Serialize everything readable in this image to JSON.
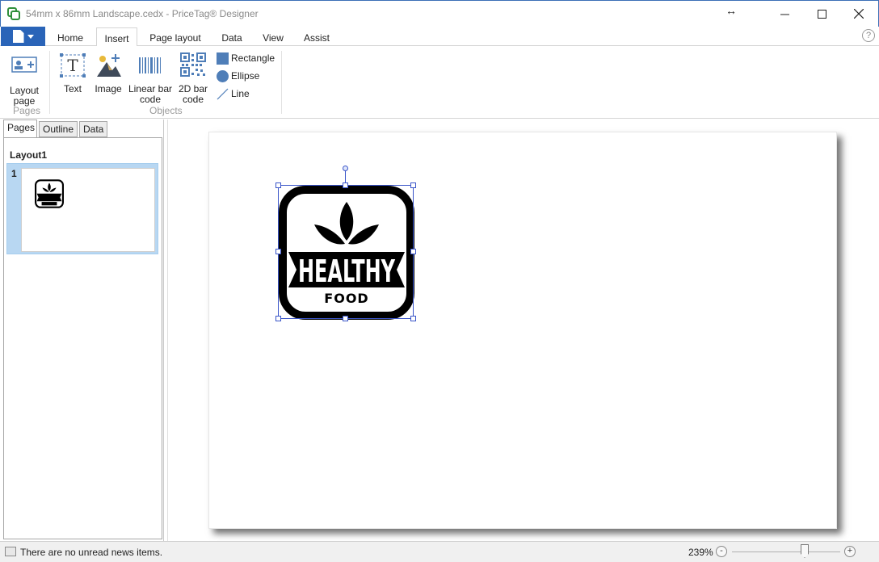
{
  "window": {
    "title": "54mm x 86mm Landscape.cedx - PriceTag® Designer",
    "resize_glyph": "↔"
  },
  "ribbon": {
    "tabs": [
      {
        "label": "Home",
        "active": false
      },
      {
        "label": "Insert",
        "active": true
      },
      {
        "label": "Page layout",
        "active": false
      },
      {
        "label": "Data",
        "active": false
      },
      {
        "label": "View",
        "active": false
      },
      {
        "label": "Assist",
        "active": false
      }
    ],
    "help_glyph": "?",
    "groups": {
      "pages": {
        "label": "Pages",
        "layout_page_line1": "Layout",
        "layout_page_line2": "page"
      },
      "objects": {
        "label": "Objects",
        "text": "Text",
        "image": "Image",
        "linear_line1": "Linear bar",
        "linear_line2": "code",
        "twod_line1": "2D bar",
        "twod_line2": "code",
        "rectangle": "Rectangle",
        "ellipse": "Ellipse",
        "line": "Line"
      }
    },
    "colors": {
      "file_button": "#2a64b8",
      "shape_blue": "#4f7eb8"
    }
  },
  "left_panel": {
    "tabs": [
      {
        "label": "Pages",
        "active": true
      },
      {
        "label": "Outline",
        "active": false
      },
      {
        "label": "Data",
        "active": false
      }
    ],
    "layout_name": "Layout1",
    "page_number": "1"
  },
  "canvas": {
    "logo": {
      "text_main": "HEALTHY",
      "text_sub": "FOOD"
    }
  },
  "status": {
    "news": "There are no unread news items.",
    "zoom": "239%",
    "zoom_minus": "-",
    "zoom_plus": "+"
  }
}
